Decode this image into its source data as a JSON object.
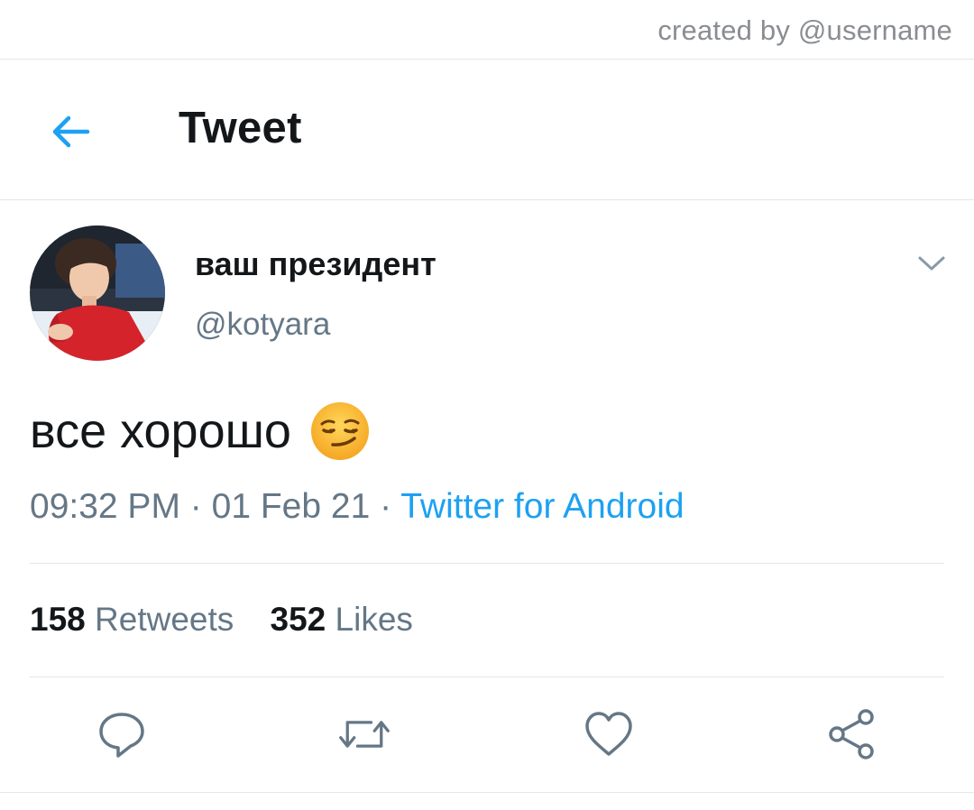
{
  "watermark": "created by @username",
  "header": {
    "title": "Tweet",
    "back_icon": "arrow-left-icon"
  },
  "tweet": {
    "display_name": "ваш президент",
    "handle": "@kotyara",
    "text": "все хорошо",
    "emoji": "smirking-face",
    "time": "09:32 PM",
    "separator": "·",
    "date": "01 Feb 21",
    "source": "Twitter for Android"
  },
  "stats": {
    "retweets_count": "158",
    "retweets_label": "Retweets",
    "likes_count": "352",
    "likes_label": "Likes"
  },
  "actions": [
    "reply-icon",
    "retweet-icon",
    "like-icon",
    "share-icon"
  ],
  "colors": {
    "accent": "#1da1f2",
    "text_primary": "#14171a",
    "text_secondary": "#657786",
    "divider": "#e1e8ed",
    "icon_gray": "#657786"
  }
}
